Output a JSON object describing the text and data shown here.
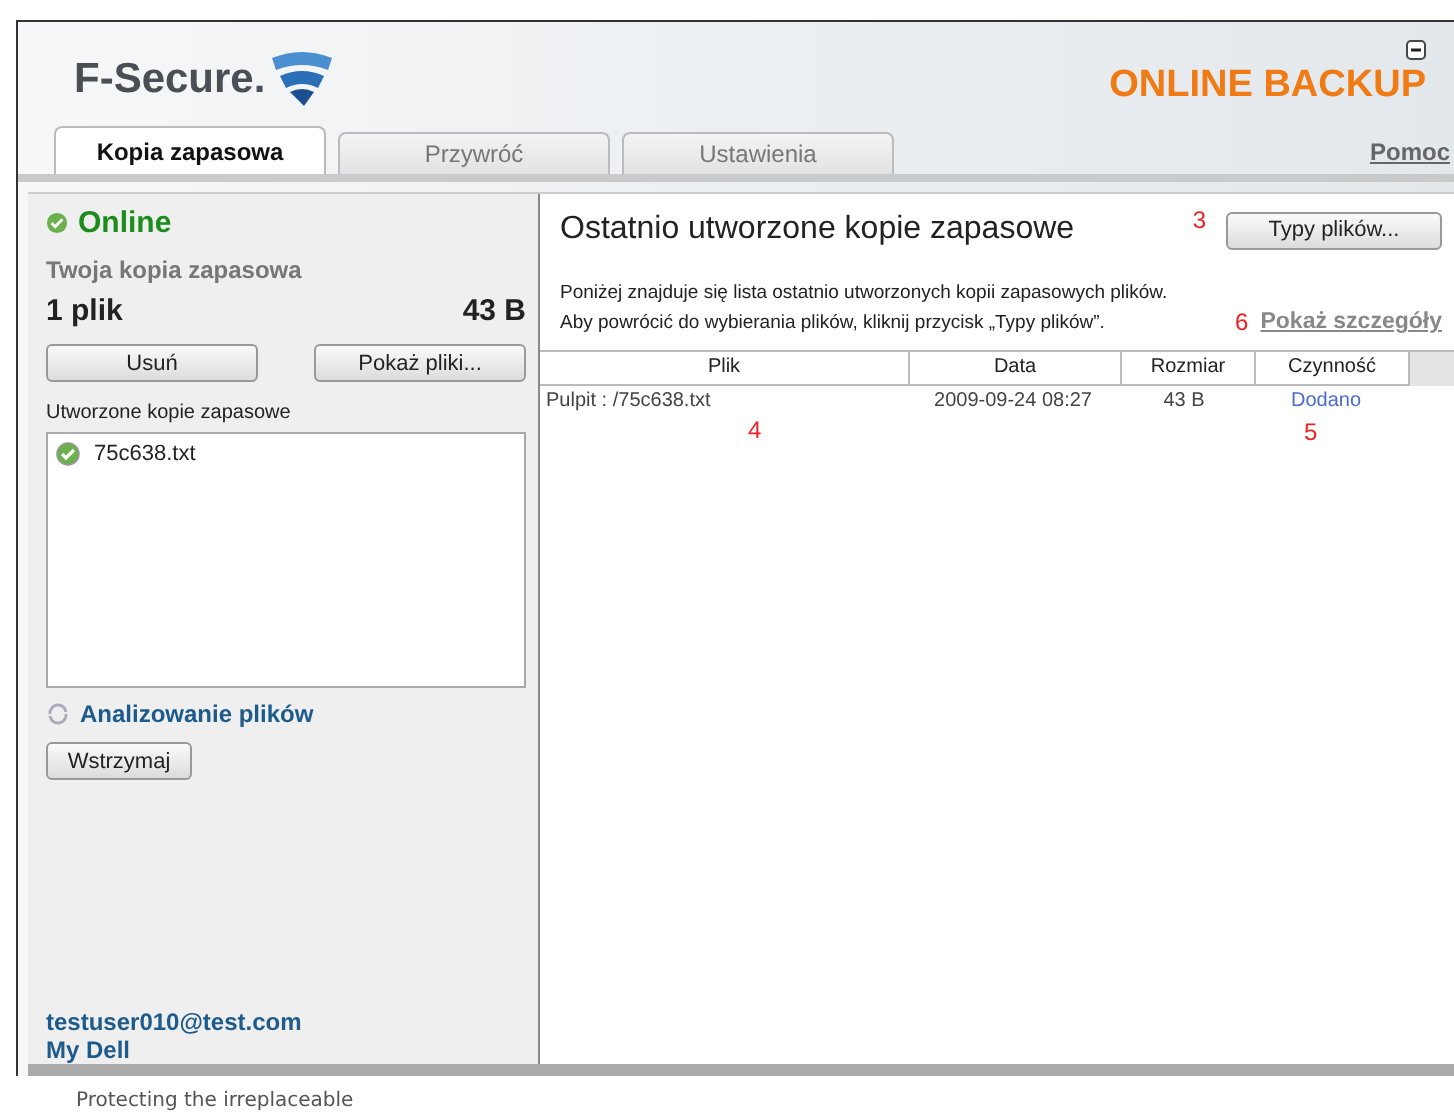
{
  "header": {
    "logo_text": "F-Secure.",
    "product": "ONLINE BACKUP"
  },
  "tabs": [
    {
      "label": "Kopia zapasowa",
      "selected": true
    },
    {
      "label": "Przywróć",
      "selected": false
    },
    {
      "label": "Ustawienia",
      "selected": false
    }
  ],
  "help_link": "Pomoc",
  "left": {
    "status": "Online",
    "backup_title": "Twoja kopia zapasowa",
    "file_count": "1 plik",
    "size": "43 B",
    "buttons": [
      "Usuń",
      "Pokaż pliki..."
    ],
    "list_label": "Utworzone kopie zapasowe",
    "backups": [
      {
        "name": "75c638.txt"
      }
    ],
    "activity": "Analizowanie plików",
    "pause_button": "Wstrzymaj",
    "account": "testuser010@test.com",
    "device": "My Dell"
  },
  "right": {
    "title": "Ostatnio utworzone kopie zapasowe",
    "file_types_button": "Typy plików...",
    "description": [
      "Poniżej znajduje się lista ostatnio utworzonych kopii zapasowych plików.",
      "Aby powrócić do wybierania plików, kliknij przycisk „Typy plików”."
    ],
    "details_link": "Pokaż szczegóły",
    "table": {
      "columns": [
        "Plik",
        "Data",
        "Rozmiar",
        "Czynność"
      ],
      "rows": [
        {
          "file": "Pulpit : /75c638.txt",
          "date": "2009-09-24 08:27",
          "size": "43 B",
          "action": "Dodano"
        }
      ]
    },
    "markers": [
      "3",
      "4",
      "5",
      "6"
    ]
  },
  "footer": "Protecting the irreplaceable"
}
